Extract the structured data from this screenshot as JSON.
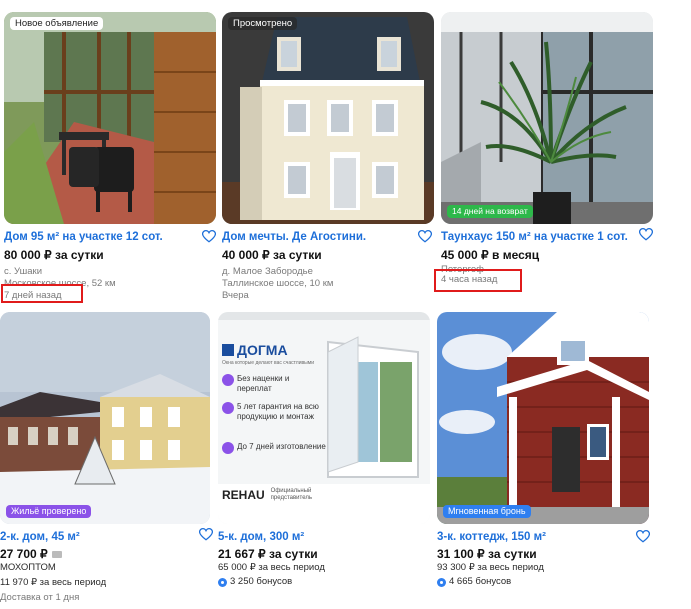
{
  "cards": [
    {
      "badge": "Новое объявление",
      "title": "Дом 95 м² на участке 12 сот.",
      "price": "80 000 ₽ за сутки",
      "location": "с. Ушаки",
      "road": "Московское шоссе, 52 км",
      "posted": "7 дней назад"
    },
    {
      "badge": "Просмотрено",
      "title": "Дом мечты. Де Агостини.",
      "price": "40 000 ₽ за сутки",
      "location": "д. Малое Забородье",
      "road": "Таллинское шоссе, 10 км",
      "posted": "Вчера"
    },
    {
      "badge": "14 дней на возврат",
      "title": "Таунхаус 150 м² на участке 1 сот.",
      "price": "45 000 ₽ в месяц",
      "location": "Петергоф",
      "posted": "4 часа назад"
    },
    {
      "badge": "Жильё проверено",
      "title": "2-к. дом, 45 м²",
      "price": "27 700 ₽",
      "location": "МОХОПТОМ",
      "total": "11 970 ₽ за весь период",
      "delivery": "Доставка от 1 дня"
    },
    {
      "title": "5-к. дом, 300 м²",
      "price": "21 667 ₽ за сутки",
      "total": "65 000 ₽ за весь период",
      "bonus": "3 250 бонусов",
      "ad": {
        "brand": "ДОГМА",
        "tagline": "Окна которые делают вас счастливыми",
        "benefits": [
          "Без наценки и переплат",
          "5 лет гарантия на всю продукцию и монтаж",
          "До 7 дней изготовление"
        ],
        "partner": "REHAU",
        "partner_note": "Официальный представитель"
      }
    },
    {
      "badge": "Мгновенная бронь",
      "title": "3-к. коттедж, 150 м²",
      "price": "31 100 ₽ за сутки",
      "total": "93 300 ₽ за весь период",
      "bonus": "4 665 бонусов"
    }
  ],
  "colors": {
    "link": "#1e6fd9",
    "highlight": "#e01b1b",
    "badge_green": "#2db84a",
    "badge_purple": "#8b52e8",
    "badge_blue": "#2f7ff0"
  }
}
